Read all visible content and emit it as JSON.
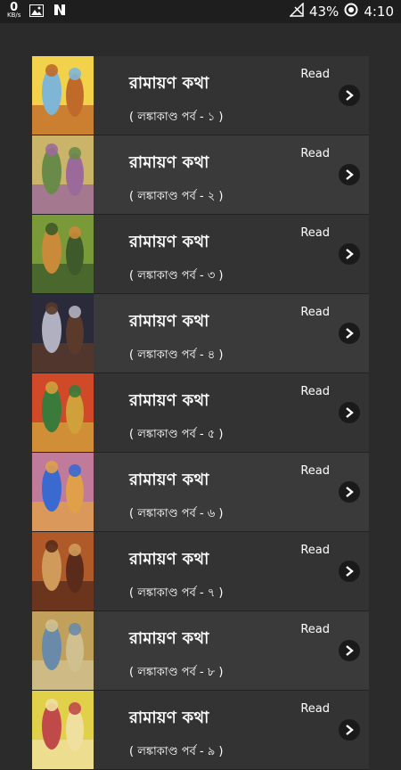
{
  "status": {
    "speed_value": "0",
    "speed_unit": "KB/s",
    "battery": "43%",
    "time": "4:10"
  },
  "items": [
    {
      "title": "রামায়ণ কথা",
      "subtitle": "( লঙ্কাকাণ্ড পর্ব - ১ )",
      "action": "Read",
      "colors": [
        "#f2d24a",
        "#7fb6d6",
        "#c06a2a"
      ]
    },
    {
      "title": "রামায়ণ কথা",
      "subtitle": "( লঙ্কাকাণ্ড পর্ব - ২ )",
      "action": "Read",
      "colors": [
        "#c9b46a",
        "#6a8a4a",
        "#9b6a9a"
      ]
    },
    {
      "title": "রামায়ণ কথা",
      "subtitle": "( লঙ্কাকাণ্ড পর্ব - ৩ )",
      "action": "Read",
      "colors": [
        "#7a9a3a",
        "#c98a3a",
        "#3e5a2a"
      ]
    },
    {
      "title": "রামায়ণ কথা",
      "subtitle": "( লঙ্কাকাণ্ড পর্ব - ৪ )",
      "action": "Read",
      "colors": [
        "#2a2a3a",
        "#b0b0c0",
        "#5a3a2a"
      ]
    },
    {
      "title": "রামায়ণ কথা",
      "subtitle": "( লঙ্কাকাণ্ড পর্ব - ৫ )",
      "action": "Read",
      "colors": [
        "#d04a2a",
        "#3a7a3a",
        "#d0a03a"
      ]
    },
    {
      "title": "রামায়ণ কথা",
      "subtitle": "( লঙ্কাকাণ্ড পর্ব - ৬ )",
      "action": "Read",
      "colors": [
        "#c07a9a",
        "#3a6ad0",
        "#e0a04a"
      ]
    },
    {
      "title": "রামায়ণ কথা",
      "subtitle": "( লঙ্কাকাণ্ড পর্ব - ৭ )",
      "action": "Read",
      "colors": [
        "#b05a2a",
        "#d09a5a",
        "#5a2a1a"
      ]
    },
    {
      "title": "রামায়ণ কথা",
      "subtitle": "( লঙ্কাকাণ্ড পর্ব - ৮ )",
      "action": "Read",
      "colors": [
        "#c0a05a",
        "#6a8aaa",
        "#d0c090"
      ]
    },
    {
      "title": "রামায়ণ কথা",
      "subtitle": "( লঙ্কাকাণ্ড পর্ব - ৯ )",
      "action": "Read",
      "colors": [
        "#e0d04a",
        "#c04a4a",
        "#f0e0a0"
      ]
    }
  ]
}
